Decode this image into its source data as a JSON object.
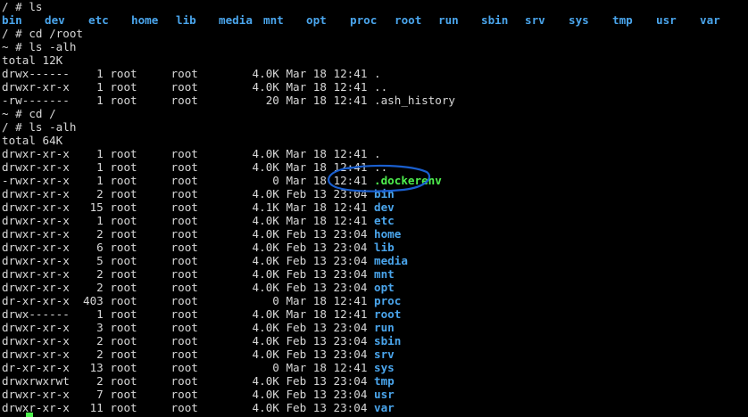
{
  "terminal": {
    "ls_root_dirs": [
      "bin",
      "dev",
      "etc",
      "home",
      "lib",
      "media",
      "mnt",
      "opt",
      "proc",
      "root",
      "run",
      "sbin",
      "srv",
      "sys",
      "tmp",
      "usr",
      "var"
    ],
    "lines": [
      {
        "type": "prompt",
        "text": "/ # ls"
      },
      {
        "type": "ls"
      },
      {
        "type": "prompt",
        "text": "/ # cd /root"
      },
      {
        "type": "prompt",
        "text": "~ # ls -alh"
      },
      {
        "type": "plain",
        "text": "total 12K"
      },
      {
        "type": "entry",
        "prefix": "drwx------    1 root     root        4.0K Mar 18 12:41 ",
        "name": ".",
        "cls": "plain"
      },
      {
        "type": "entry",
        "prefix": "drwxr-xr-x    1 root     root        4.0K Mar 18 12:41 ",
        "name": "..",
        "cls": "plain"
      },
      {
        "type": "entry",
        "prefix": "-rw-------    1 root     root          20 Mar 18 12:41 ",
        "name": ".ash_history",
        "cls": "plain"
      },
      {
        "type": "prompt",
        "text": "~ # cd /"
      },
      {
        "type": "prompt",
        "text": "/ # ls -alh"
      },
      {
        "type": "plain",
        "text": "total 64K"
      },
      {
        "type": "entry",
        "prefix": "drwxr-xr-x    1 root     root        4.0K Mar 18 12:41 ",
        "name": ".",
        "cls": "plain"
      },
      {
        "type": "entry",
        "prefix": "drwxr-xr-x    1 root     root        4.0K Mar 18 12:41 ",
        "name": "..",
        "cls": "plain"
      },
      {
        "type": "entry",
        "prefix": "-rwxr-xr-x    1 root     root           0 Mar 18 12:41 ",
        "name": ".dockerenv",
        "cls": "exe"
      },
      {
        "type": "entry",
        "prefix": "drwxr-xr-x    2 root     root        4.0K Feb 13 23:04 ",
        "name": "bin",
        "cls": "dir"
      },
      {
        "type": "entry",
        "prefix": "drwxr-xr-x   15 root     root        4.1K Mar 18 12:41 ",
        "name": "dev",
        "cls": "dir"
      },
      {
        "type": "entry",
        "prefix": "drwxr-xr-x    1 root     root        4.0K Mar 18 12:41 ",
        "name": "etc",
        "cls": "dir"
      },
      {
        "type": "entry",
        "prefix": "drwxr-xr-x    2 root     root        4.0K Feb 13 23:04 ",
        "name": "home",
        "cls": "dir"
      },
      {
        "type": "entry",
        "prefix": "drwxr-xr-x    6 root     root        4.0K Feb 13 23:04 ",
        "name": "lib",
        "cls": "dir"
      },
      {
        "type": "entry",
        "prefix": "drwxr-xr-x    5 root     root        4.0K Feb 13 23:04 ",
        "name": "media",
        "cls": "dir"
      },
      {
        "type": "entry",
        "prefix": "drwxr-xr-x    2 root     root        4.0K Feb 13 23:04 ",
        "name": "mnt",
        "cls": "dir"
      },
      {
        "type": "entry",
        "prefix": "drwxr-xr-x    2 root     root        4.0K Feb 13 23:04 ",
        "name": "opt",
        "cls": "dir"
      },
      {
        "type": "entry",
        "prefix": "dr-xr-xr-x  403 root     root           0 Mar 18 12:41 ",
        "name": "proc",
        "cls": "dir"
      },
      {
        "type": "entry",
        "prefix": "drwx------    1 root     root        4.0K Mar 18 12:41 ",
        "name": "root",
        "cls": "dir"
      },
      {
        "type": "entry",
        "prefix": "drwxr-xr-x    3 root     root        4.0K Feb 13 23:04 ",
        "name": "run",
        "cls": "dir"
      },
      {
        "type": "entry",
        "prefix": "drwxr-xr-x    2 root     root        4.0K Feb 13 23:04 ",
        "name": "sbin",
        "cls": "dir"
      },
      {
        "type": "entry",
        "prefix": "drwxr-xr-x    2 root     root        4.0K Feb 13 23:04 ",
        "name": "srv",
        "cls": "dir"
      },
      {
        "type": "entry",
        "prefix": "dr-xr-xr-x   13 root     root           0 Mar 18 12:41 ",
        "name": "sys",
        "cls": "dir"
      },
      {
        "type": "entry",
        "prefix": "drwxrwxrwt    2 root     root        4.0K Feb 13 23:04 ",
        "name": "tmp",
        "cls": "dir"
      },
      {
        "type": "entry",
        "prefix": "drwxr-xr-x    7 root     root        4.0K Feb 13 23:04 ",
        "name": "usr",
        "cls": "dir"
      },
      {
        "type": "entry",
        "prefix": "drwxr-xr-x   11 root     root        4.0K Feb 13 23:04 ",
        "name": "var",
        "cls": "dir"
      },
      {
        "type": "prompt",
        "text": "/ # "
      }
    ]
  },
  "colors": {
    "background": "#000000",
    "text": "#d8d8d8",
    "directory": "#4aa5ec",
    "executable": "#4ef04e",
    "annotation": "#1a5fcf",
    "cursor": "#4ef04e"
  }
}
